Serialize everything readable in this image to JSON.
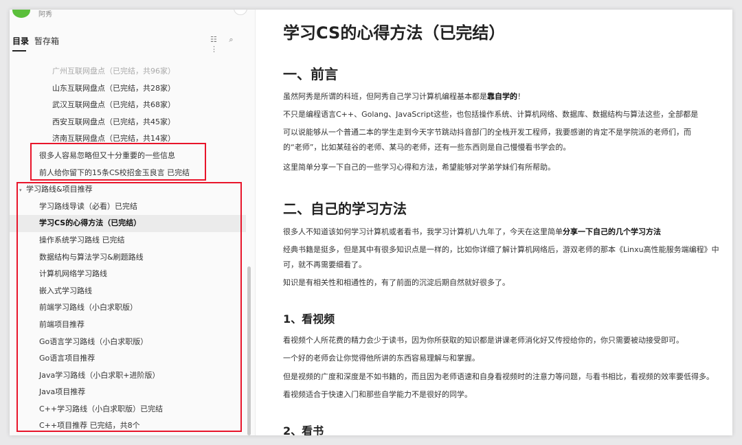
{
  "sidebar": {
    "author": "阿秀",
    "tabs": [
      "目录",
      "暂存箱"
    ],
    "tool_icons": "☷ ⌕ ⋮",
    "items": [
      {
        "label": "广州互联网盘点（已完结，共96家）",
        "level": 2,
        "faded": true
      },
      {
        "label": "山东互联网盘点（已完结，共28家）",
        "level": 2
      },
      {
        "label": "武汉互联网盘点（已完结，共68家）",
        "level": 2
      },
      {
        "label": "西安互联网盘点（已完结，共45家）",
        "level": 2
      },
      {
        "label": "济南互联网盘点（已完结，共14家）",
        "level": 2
      },
      {
        "label": "很多人容易忽略但又十分重要的一些信息",
        "level": 1
      },
      {
        "label": "前人给你留下的15条CS校招金玉良言 已完结",
        "level": 1
      },
      {
        "label": "学习路线&项目推荐",
        "level": 0,
        "caret": "▾"
      },
      {
        "label": "学习路线导读（必看）已完结",
        "level": 1
      },
      {
        "label": "学习CS的心得方法（已完结）",
        "level": 1,
        "active": true
      },
      {
        "label": "操作系统学习路线 已完结",
        "level": 1
      },
      {
        "label": "数据结构与算法学习&刷题路线",
        "level": 1
      },
      {
        "label": "计算机网络学习路线",
        "level": 1
      },
      {
        "label": "嵌入式学习路线",
        "level": 1
      },
      {
        "label": "前端学习路线（小白求职版）",
        "level": 1
      },
      {
        "label": "前端项目推荐",
        "level": 1
      },
      {
        "label": "Go语言学习路线（小白求职版）",
        "level": 1
      },
      {
        "label": "Go语言项目推荐",
        "level": 1
      },
      {
        "label": "Java学习路线（小白求职+进阶版）",
        "level": 1
      },
      {
        "label": "Java项目推荐",
        "level": 1
      },
      {
        "label": "C++学习路线（小白求职版）已完结",
        "level": 1
      },
      {
        "label": "C++项目推荐 已完结，共8个",
        "level": 1
      }
    ]
  },
  "content": {
    "title": "学习CS的心得方法（已完结）",
    "h1_intro": "一、前言",
    "intro": [
      {
        "pre": "虽然阿秀是所谓的科班，但阿秀自己学习计算机编程基本都是",
        "bold": "靠自学的",
        "post": "！"
      },
      {
        "pre": "不只是编程语言C++、Golang、JavaScript这些，也包括操作系统、计算机网络、数据库、数据结构与算法这些，全部都是"
      },
      {
        "pre": "可以说能够从一个普通二本的学生走到今天字节跳动抖音部门的全栈开发工程师，我要感谢的肯定不是学院派的老师们，而"
      },
      {
        "pre": "的“老师”，比如某硅谷的老师、某马的老师，还有一些东西则是自己慢慢看书学会的。"
      },
      {
        "pre": "这里简单分享一下自己的一些学习心得和方法，希望能够对学弟学妹们有所帮助。"
      }
    ],
    "h1_method": "二、自己的学习方法",
    "method": [
      {
        "pre": "很多人不知道该如何学习计算机或者看书，我学习计算机八九年了，今天在这里简单",
        "bold": "分享一下自己的几个学习方法"
      },
      {
        "pre": "经典书籍是挺多，但是其中有很多知识点是一样的，比如你详细了解计算机网络后，游双老师的那本《Linxu高性能服务端编程》中"
      },
      {
        "pre": "可，就不再需要细看了。"
      },
      {
        "pre": "知识是有相关性和相通性的，有了前面的沉淀后期自然就好很多了。"
      }
    ],
    "h2_video": "1、看视频",
    "video": [
      {
        "pre": "看视频个人所花费的精力会少于读书，因为你所获取的知识都是讲课老师消化好又传授给你的，你只需要被动接受即可。"
      },
      {
        "pre": "一个好的老师会让你觉得他所讲的东西容易理解与和掌握。"
      },
      {
        "pre": "但是视频的广度和深度是不如书籍的，而且因为老师语速和自身看视频时的注意力等问题，与看书相比，看视频的效率要低得多。"
      },
      {
        "pre": "看视频适合于快速入门和那些自学能力不是很好的同学。"
      }
    ],
    "h2_book": "2、看书"
  }
}
